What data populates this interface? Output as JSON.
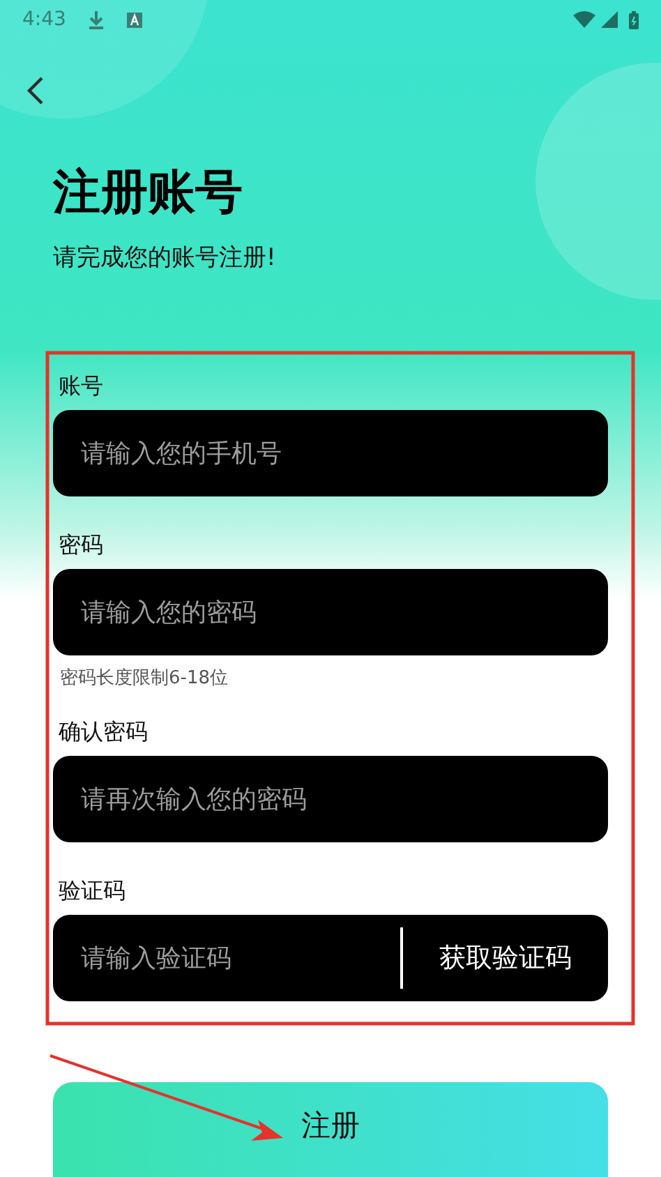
{
  "status_bar": {
    "time": "4:43"
  },
  "header": {
    "title": "注册账号",
    "subtitle": "请完成您的账号注册!"
  },
  "fields": [
    {
      "kind": "text",
      "label": "账号",
      "placeholder": "请输入您的手机号"
    },
    {
      "kind": "text",
      "label": "密码",
      "placeholder": "请输入您的密码",
      "hint": "密码长度限制6-18位"
    },
    {
      "kind": "text",
      "label": "确认密码",
      "placeholder": "请再次输入您的密码"
    },
    {
      "kind": "code",
      "label": "验证码",
      "placeholder": "请输入验证码",
      "action": "获取验证码"
    }
  ],
  "submit": {
    "label": "注册"
  }
}
